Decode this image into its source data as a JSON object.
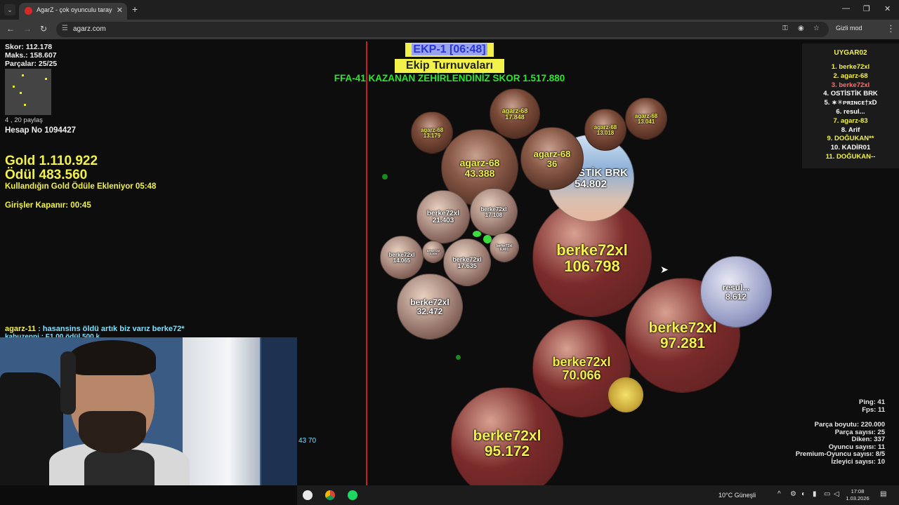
{
  "browser": {
    "tab_title": "AgarZ - çok oyunculu tarayıcı o",
    "url": "agarz.com",
    "incognito_label": "Gizli mod",
    "brand_color": "#d42a2a"
  },
  "hud": {
    "score": "Skor: 112.178",
    "max": "Maks.: 158.607",
    "parts": "Parçalar: 25/25",
    "shares": "4 , 20 paylaş",
    "account": "Hesap No 1094427",
    "gold": "Gold 1.110.922",
    "reward": "Ödül 483.560",
    "gold_note": "Kullandığın Gold Ödüle Ekleniyor 05:48",
    "entries_close": "Girişler Kapanır: 00:45"
  },
  "chat": {
    "line1_user": "agarz-11",
    "line1_msg": " : hasansins öldü artık biz varız berke72*",
    "line2": "kabuzenni : F1 00 ödül 500 k"
  },
  "coords": "43 70",
  "banner": {
    "team": "EKP-1 [06:48]",
    "tournament": "Ekip Turnuvaları",
    "announcement": "FFA-41 KAZANAN ZEHİRLENDİNİZ SKOR 1.517.880"
  },
  "leaderboard": {
    "title": "UYGAR02",
    "entries": [
      {
        "text": "1. berke72xl",
        "color": "#f2f24a"
      },
      {
        "text": "2. agarz-68",
        "color": "#f2f24a"
      },
      {
        "text": "3. berke72xl",
        "color": "#ff7070"
      },
      {
        "text": "4. OSTİSTİK BRK",
        "color": "#ffffff"
      },
      {
        "text": "5. ∗✳ᴘʀɪɴᴄᴇ†xD",
        "color": "#ffffff"
      },
      {
        "text": "6. resul...",
        "color": "#ffffff"
      },
      {
        "text": "7. agarz-83",
        "color": "#f2f24a"
      },
      {
        "text": "8. Arif",
        "color": "#ffffff"
      },
      {
        "text": "9. DOĞUKAN**",
        "color": "#f2f24a"
      },
      {
        "text": "10. KADİR01",
        "color": "#ffffff"
      },
      {
        "text": "11. DOĞUKAN--",
        "color": "#f2f24a"
      }
    ]
  },
  "stats": {
    "ping": "Ping: 41",
    "fps": "Fps: 11",
    "part_size": "Parça boyutu: 220.000",
    "part_count": "Parça sayısı: 25",
    "spikes": "Diken: 337",
    "players": "Oyuncu sayısı: 11",
    "premium": "Premium-Oyuncu sayısı: 8/5",
    "viewers": "İzleyici sayısı: 10"
  },
  "cells": [
    {
      "name": "berke72xl",
      "mass": "106.798",
      "color": "#7a2a2a",
      "theme": "bed"
    },
    {
      "name": "berke72xl",
      "mass": "97.281",
      "color": "#7a2a2a",
      "theme": "bed"
    },
    {
      "name": "berke72xl",
      "mass": "95.172",
      "color": "#7a2a2a",
      "theme": "bed"
    },
    {
      "name": "berke72xl",
      "mass": "70.066",
      "color": "#7a2a2a",
      "theme": "bed"
    },
    {
      "name": "OSTİSTİK BRK",
      "mass": "54.802",
      "color": "#8fb0d8",
      "theme": "sky"
    },
    {
      "name": "agarz-68",
      "mass": "43.388",
      "color": "#8a5a48",
      "theme": "portrait"
    },
    {
      "name": "agarz-68",
      "mass": "36",
      "color": "#8a5a48",
      "theme": "portrait"
    },
    {
      "name": "berke72xl",
      "mass": "32.472",
      "color": "#9a7a70",
      "theme": "beige"
    },
    {
      "name": "berke72xl",
      "mass": "21.403",
      "color": "#9a7a70",
      "theme": "beige"
    },
    {
      "name": "berke72xl",
      "mass": "17.635",
      "color": "#9a7a70",
      "theme": "beige"
    },
    {
      "name": "berke72xl",
      "mass": "17.108",
      "color": "#9a7a70",
      "theme": "beige"
    },
    {
      "name": "berke72xl",
      "mass": "14.065",
      "color": "#9a7a70",
      "theme": "beige"
    },
    {
      "name": "berke72xl",
      "mass": "6.401",
      "color": "#9a7a70",
      "theme": "beige"
    },
    {
      "name": "berke72xl",
      "mass": "3.500",
      "color": "#9a7a70",
      "theme": "beige"
    },
    {
      "name": "agarz-68",
      "mass": "17.848",
      "color": "#7a4a38",
      "theme": "portrait"
    },
    {
      "name": "agarz-68",
      "mass": "13.179",
      "color": "#7a4a38",
      "theme": "portrait"
    },
    {
      "name": "agarz-68",
      "mass": "13.018",
      "color": "#7a4a38",
      "theme": "portrait"
    },
    {
      "name": "agarz-68",
      "mass": "13.041",
      "color": "#7a4a38",
      "theme": "portrait"
    },
    {
      "name": "resul...",
      "mass": "8.612",
      "color": "#9aa0c8",
      "theme": "lavender"
    }
  ],
  "taskbar": {
    "weather": "10°C  Güneşli",
    "time": "17:08",
    "date": "1.03.2026"
  }
}
